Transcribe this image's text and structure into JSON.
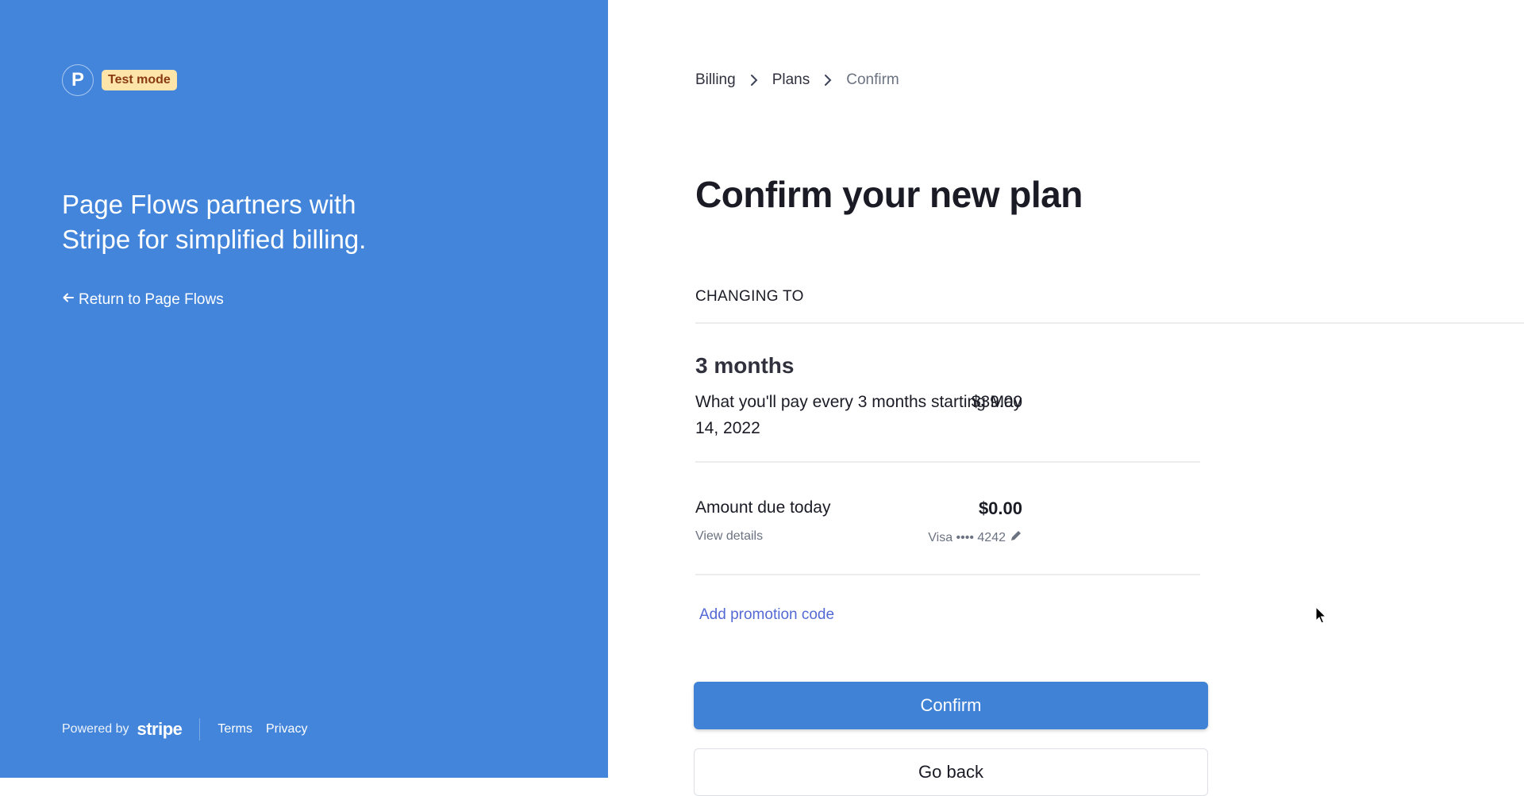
{
  "brand": {
    "logo_letter": "P",
    "badge": "Test mode",
    "tagline": "Page Flows partners with Stripe for simplified billing.",
    "return_link": "Return to Page Flows",
    "colors": {
      "panel": "#4385db",
      "badge_bg": "#fde4a8",
      "badge_text": "#8a3a12"
    }
  },
  "footer": {
    "powered_by": "Powered by",
    "stripe": "stripe",
    "links": [
      "Terms",
      "Privacy"
    ]
  },
  "breadcrumb": [
    "Billing",
    "Plans",
    "Confirm"
  ],
  "page_title": "Confirm your new plan",
  "section_label": "CHANGING TO",
  "plan": {
    "name": "3 months",
    "description": "What you'll pay every 3 months starting May 14, 2022",
    "price": "$39.00"
  },
  "due": {
    "label": "Amount due today",
    "amount": "$0.00",
    "view_details": "View details",
    "card": "Visa •••• 4242"
  },
  "promo_link": "Add promotion code",
  "buttons": {
    "confirm": "Confirm",
    "back": "Go back"
  },
  "colors": {
    "accent": "#3f82d6",
    "link": "#5469d4"
  }
}
